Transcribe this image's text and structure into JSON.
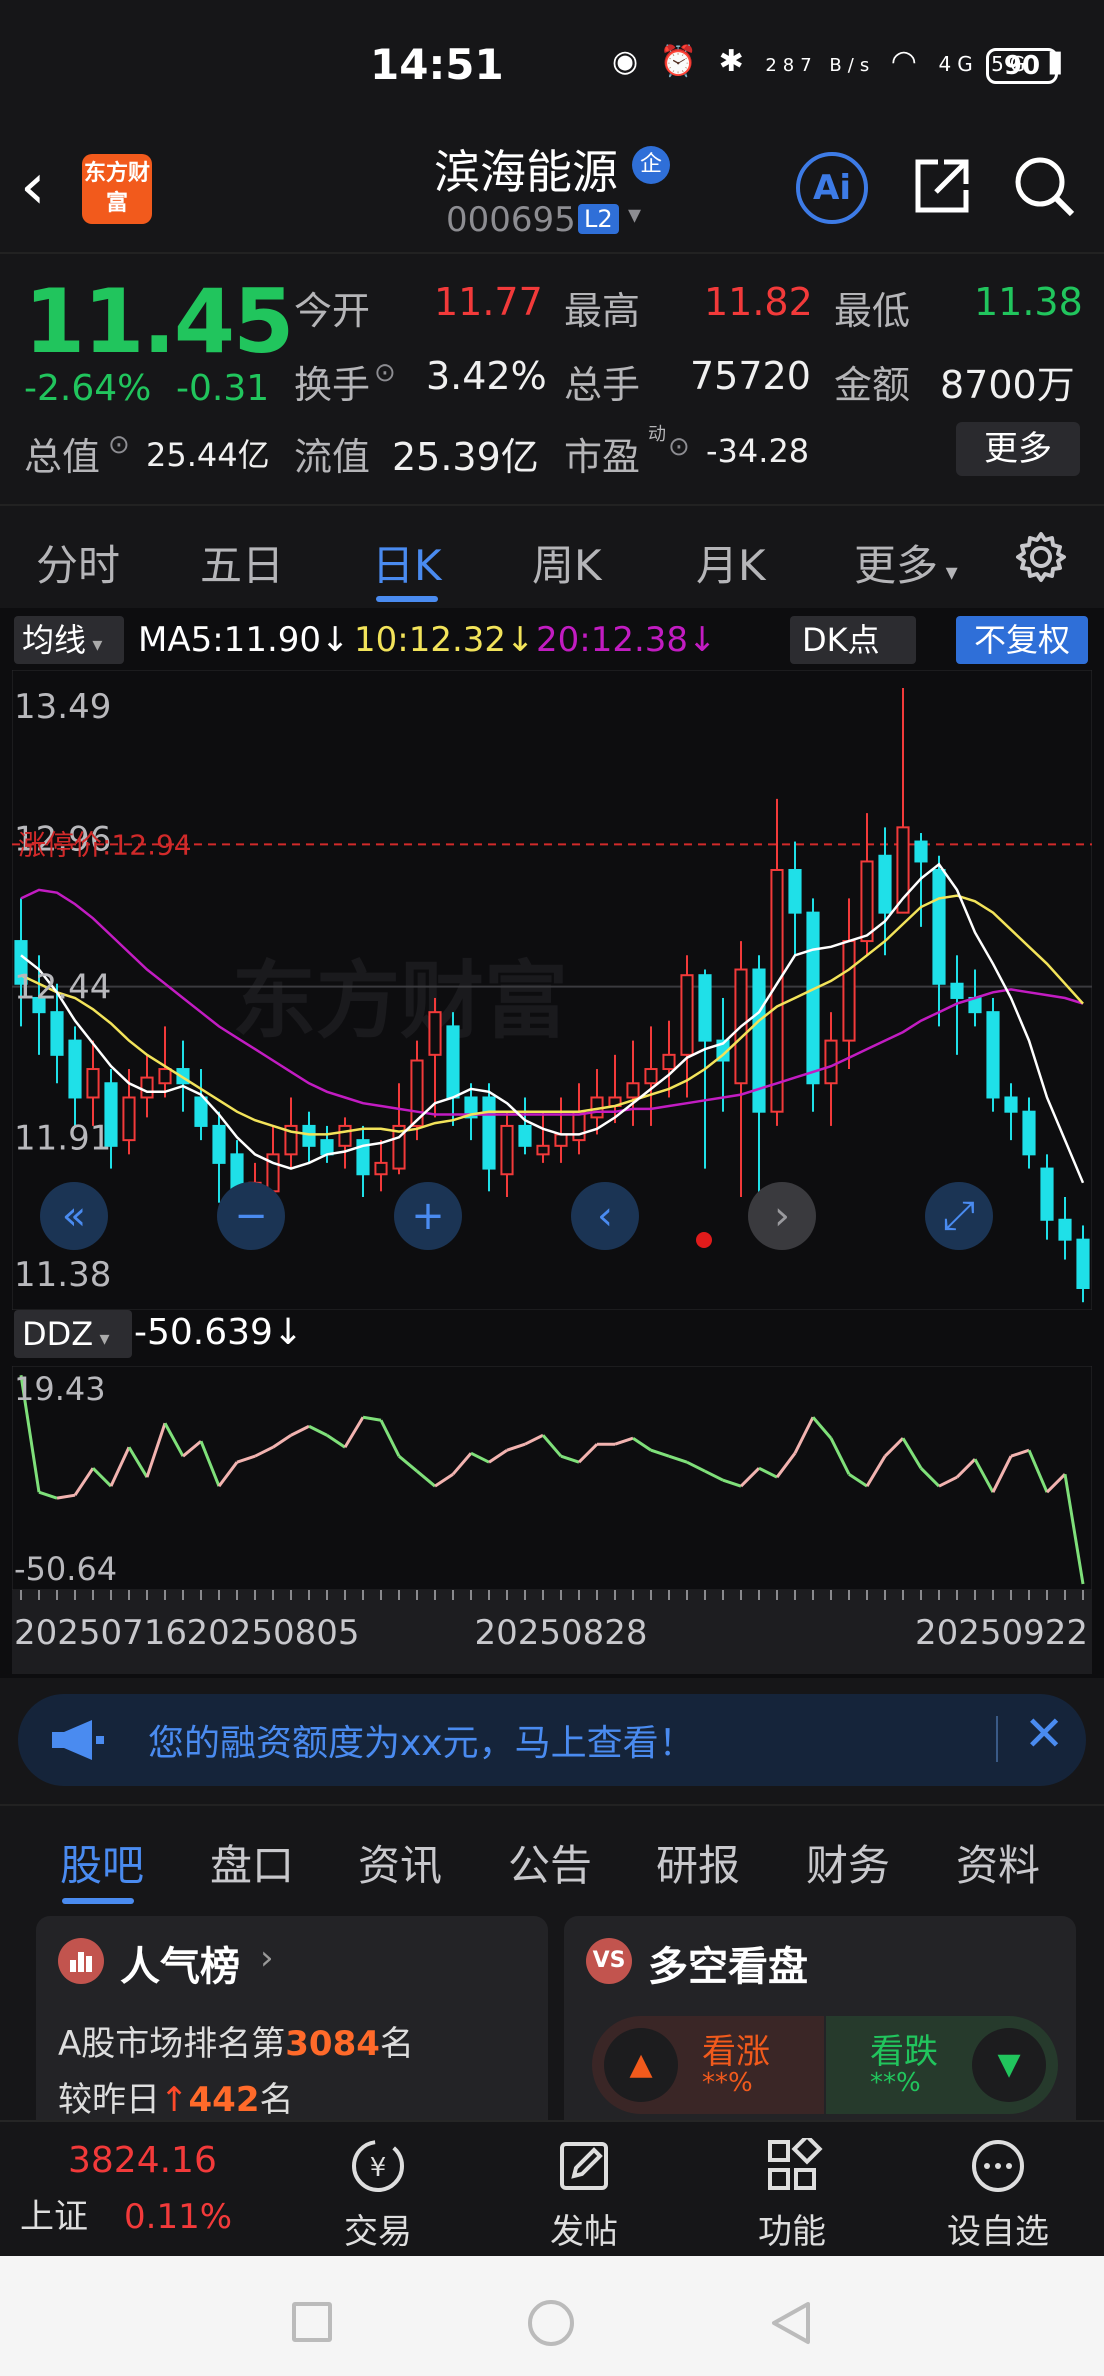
{
  "status_bar": {
    "time": "14:51",
    "net_speed": "287 B/s",
    "battery": "90",
    "network": "4G 5G"
  },
  "header": {
    "title": "滨海能源",
    "badge": "企",
    "code": "000695",
    "level": "L2",
    "logo_text": "东方财富",
    "ai_label": "Ai"
  },
  "quote": {
    "price": "11.45",
    "change_pct": "-2.64%",
    "change": "-0.31",
    "open_label": "今开",
    "open": "11.77",
    "high_label": "最高",
    "high": "11.82",
    "low_label": "最低",
    "low": "11.38",
    "turnover_label": "换手",
    "turnover": "3.42%",
    "volume_label": "总手",
    "volume": "75720",
    "amount_label": "金额",
    "amount": "8700万",
    "mktcap_label": "总值",
    "mktcap": "25.44亿",
    "float_label": "流值",
    "float_cap": "25.39亿",
    "pe_label": "市盈",
    "pe_sup": "动",
    "pe": "-34.28",
    "more_label": "更多"
  },
  "chart_tabs": [
    "分时",
    "五日",
    "日K",
    "周K",
    "月K",
    "更多"
  ],
  "chart_controls": {
    "ma_btn": "均线",
    "ma5": "MA5:11.90↓",
    "ma10": "10:12.32↓",
    "ma20": "20:12.38↓",
    "dk_btn": "DK点",
    "fq_btn": "不复权",
    "limit_up": "涨停价:12.94",
    "watermark": "东方财富"
  },
  "chart_data": {
    "type": "candlestick",
    "y_ticks": [
      "13.49",
      "12.96",
      "12.44",
      "11.91",
      "11.38"
    ],
    "ylim": [
      11.38,
      13.49
    ],
    "limit_up_price": 12.94,
    "x_ticks": [
      "20250716",
      "20250805",
      "20250828",
      "20250922"
    ],
    "candles": [
      [
        12.6,
        12.45,
        12.75,
        12.3
      ],
      [
        12.4,
        12.35,
        12.55,
        12.2
      ],
      [
        12.35,
        12.2,
        12.45,
        12.1
      ],
      [
        12.25,
        12.05,
        12.3,
        11.95
      ],
      [
        12.05,
        12.15,
        12.25,
        11.95
      ],
      [
        12.1,
        11.88,
        12.15,
        11.8
      ],
      [
        11.9,
        12.05,
        12.15,
        11.85
      ],
      [
        12.05,
        12.12,
        12.2,
        11.98
      ],
      [
        12.1,
        12.15,
        12.3,
        12.05
      ],
      [
        12.15,
        12.1,
        12.25,
        12.0
      ],
      [
        12.05,
        11.95,
        12.15,
        11.9
      ],
      [
        11.95,
        11.82,
        12.0,
        11.68
      ],
      [
        11.85,
        11.65,
        11.9,
        11.58
      ],
      [
        11.7,
        11.75,
        11.82,
        11.62
      ],
      [
        11.72,
        11.85,
        11.95,
        11.62
      ],
      [
        11.85,
        11.95,
        12.05,
        11.8
      ],
      [
        11.95,
        11.88,
        12.0,
        11.82
      ],
      [
        11.9,
        11.85,
        11.95,
        11.82
      ],
      [
        11.88,
        11.95,
        11.98,
        11.8
      ],
      [
        11.9,
        11.78,
        11.95,
        11.7
      ],
      [
        11.78,
        11.82,
        11.9,
        11.72
      ],
      [
        11.8,
        11.95,
        12.1,
        11.78
      ],
      [
        11.95,
        12.18,
        12.25,
        11.9
      ],
      [
        12.2,
        12.35,
        12.4,
        11.98
      ],
      [
        12.3,
        12.05,
        12.35,
        11.95
      ],
      [
        12.05,
        11.98,
        12.1,
        11.9
      ],
      [
        12.05,
        11.8,
        12.1,
        11.72
      ],
      [
        11.78,
        11.95,
        12.0,
        11.7
      ],
      [
        11.95,
        11.88,
        12.05,
        11.85
      ],
      [
        11.85,
        11.88,
        12.0,
        11.82
      ],
      [
        11.88,
        11.92,
        12.05,
        11.82
      ],
      [
        11.9,
        12.0,
        12.1,
        11.85
      ],
      [
        11.98,
        12.05,
        12.15,
        11.92
      ],
      [
        12.02,
        12.05,
        12.2,
        11.96
      ],
      [
        12.05,
        12.1,
        12.25,
        11.95
      ],
      [
        12.1,
        12.15,
        12.3,
        11.95
      ],
      [
        12.15,
        12.2,
        12.32,
        12.05
      ],
      [
        12.2,
        12.48,
        12.55,
        12.05
      ],
      [
        12.48,
        12.25,
        12.5,
        11.8
      ],
      [
        12.25,
        12.18,
        12.4,
        12.0
      ],
      [
        12.1,
        12.5,
        12.6,
        11.7
      ],
      [
        12.5,
        12.0,
        12.55,
        11.65
      ],
      [
        12.0,
        12.85,
        13.1,
        11.95
      ],
      [
        12.85,
        12.7,
        12.95,
        12.55
      ],
      [
        12.7,
        12.1,
        12.75,
        12.0
      ],
      [
        12.1,
        12.25,
        12.35,
        11.95
      ],
      [
        12.25,
        12.6,
        12.75,
        12.15
      ],
      [
        12.6,
        12.88,
        13.05,
        12.55
      ],
      [
        12.9,
        12.7,
        13.0,
        12.55
      ],
      [
        12.7,
        13.0,
        13.49,
        12.75
      ],
      [
        12.95,
        12.88,
        12.98,
        12.65
      ],
      [
        12.85,
        12.45,
        12.9,
        12.3
      ],
      [
        12.45,
        12.4,
        12.55,
        12.2
      ],
      [
        12.4,
        12.35,
        12.5,
        12.3
      ],
      [
        12.35,
        12.05,
        12.4,
        12.0
      ],
      [
        12.05,
        12.0,
        12.1,
        11.9
      ],
      [
        12.0,
        11.85,
        12.05,
        11.8
      ],
      [
        11.8,
        11.62,
        11.85,
        11.55
      ],
      [
        11.62,
        11.55,
        11.7,
        11.48
      ],
      [
        11.55,
        11.38,
        11.6,
        11.33
      ]
    ],
    "ma5": [
      12.55,
      12.5,
      12.42,
      12.32,
      12.24,
      12.16,
      12.1,
      12.07,
      12.07,
      12.09,
      12.06,
      11.99,
      11.91,
      11.85,
      11.82,
      11.8,
      11.82,
      11.85,
      11.86,
      11.88,
      11.89,
      11.91,
      11.97,
      12.03,
      12.05,
      12.08,
      12.07,
      12.03,
      11.97,
      11.94,
      11.92,
      11.92,
      11.94,
      11.98,
      12.03,
      12.08,
      12.13,
      12.19,
      12.22,
      12.24,
      12.3,
      12.35,
      12.45,
      12.55,
      12.57,
      12.58,
      12.6,
      12.62,
      12.67,
      12.75,
      12.82,
      12.87,
      12.78,
      12.63,
      12.52,
      12.4,
      12.25,
      12.05,
      11.9,
      11.75
    ],
    "ma10": [
      12.48,
      12.45,
      12.42,
      12.4,
      12.36,
      12.31,
      12.25,
      12.2,
      12.16,
      12.12,
      12.08,
      12.04,
      12.0,
      11.97,
      11.95,
      11.93,
      11.92,
      11.92,
      11.93,
      11.94,
      11.94,
      11.93,
      11.94,
      11.96,
      11.97,
      11.99,
      12.0,
      12.0,
      12.0,
      12.0,
      12.0,
      12.0,
      12.01,
      12.02,
      12.04,
      12.06,
      12.08,
      12.11,
      12.15,
      12.2,
      12.26,
      12.32,
      12.37,
      12.4,
      12.43,
      12.46,
      12.5,
      12.55,
      12.6,
      12.66,
      12.72,
      12.75,
      12.76,
      12.74,
      12.7,
      12.64,
      12.58,
      12.52,
      12.45,
      12.38
    ],
    "ma20": [
      12.75,
      12.78,
      12.77,
      12.73,
      12.68,
      12.62,
      12.56,
      12.5,
      12.45,
      12.4,
      12.35,
      12.3,
      12.26,
      12.22,
      12.18,
      12.14,
      12.1,
      12.07,
      12.05,
      12.03,
      12.02,
      12.01,
      12.0,
      11.99,
      11.99,
      11.99,
      11.99,
      11.99,
      11.99,
      11.99,
      11.99,
      11.99,
      12.0,
      12.0,
      12.01,
      12.01,
      12.02,
      12.03,
      12.04,
      12.05,
      12.06,
      12.08,
      12.1,
      12.12,
      12.14,
      12.16,
      12.19,
      12.22,
      12.25,
      12.28,
      12.32,
      12.35,
      12.38,
      12.4,
      12.42,
      12.43,
      12.42,
      12.41,
      12.4,
      12.38
    ],
    "ddz_label": "DDZ",
    "ddz_value": "-50.639↓",
    "ddz_ylim": [
      -50.64,
      19.43
    ],
    "ddz_ticks": [
      "19.43",
      "-50.64"
    ],
    "ddz": [
      19,
      -20,
      -22,
      -21,
      -12,
      -18,
      -5,
      -15,
      3,
      -8,
      -3,
      -18,
      -10,
      -8,
      -5,
      -1,
      2,
      -1,
      -5,
      5,
      4,
      -8,
      -13,
      -18,
      -14,
      -7,
      -10,
      -6,
      -4,
      -1,
      -8,
      -10,
      -4,
      -4,
      -2,
      -6,
      -8,
      -10,
      -13,
      -16,
      -18,
      -12,
      -15,
      -7,
      5,
      -2,
      -14,
      -18,
      -8,
      -2,
      -12,
      -18,
      -15,
      -9,
      -20,
      -8,
      -6,
      -20,
      -14,
      -50.64
    ]
  },
  "notice": {
    "text": "您的融资额度为xx元，马上查看！"
  },
  "bottom_tabs": [
    "股吧",
    "盘口",
    "资讯",
    "公告",
    "研报",
    "财务",
    "资料"
  ],
  "cards": {
    "rank": {
      "title": "人气榜",
      "line1_pre": "A股市场排名第",
      "line1_num": "3084",
      "line1_post": "名",
      "line2_pre": "较昨日",
      "line2_num": "442",
      "line2_post": "名"
    },
    "vote": {
      "title": "多空看盘",
      "up_label": "看涨",
      "up_val": "**%",
      "down_label": "看跌",
      "down_val": "**%"
    }
  },
  "bottom_bar": {
    "index_value": "3824.16",
    "index_name": "上证",
    "index_change": "0.11%",
    "trade": "交易",
    "post": "发帖",
    "func": "功能",
    "watch": "设自选"
  },
  "colors": {
    "up": "#f23a3a",
    "down": "#21c55d",
    "candle_down": "#1fe0e8",
    "accent": "#4a8bf0",
    "ma5": "#ffffff",
    "ma10": "#f2e35a",
    "ma20": "#c21cc2"
  }
}
